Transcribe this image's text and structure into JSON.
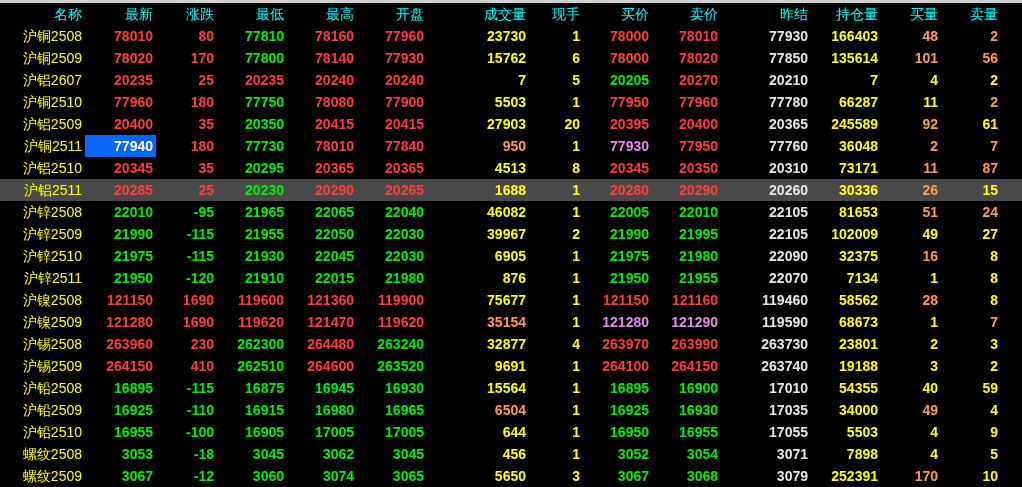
{
  "columns": [
    "名称",
    "最新",
    "涨跌",
    "最低",
    "最高",
    "开盘",
    "成交量",
    "现手",
    "买价",
    "卖价",
    "昨结",
    "持仓量",
    "买量",
    "卖量"
  ],
  "rows": [
    {
      "name": "沪铜2508",
      "selected": false,
      "cursor": false,
      "cells": [
        {
          "text": "78010",
          "color": "#ff3c3c"
        },
        {
          "text": "80",
          "color": "#ff3c3c"
        },
        {
          "text": "77810",
          "color": "#00ee00"
        },
        {
          "text": "78160",
          "color": "#ff3c3c"
        },
        {
          "text": "77960",
          "color": "#ff3c3c"
        },
        {
          "text": "23730",
          "color": "#ffff00"
        },
        {
          "text": "1",
          "color": "#ffff00"
        },
        {
          "text": "78000",
          "color": "#ff3c3c"
        },
        {
          "text": "78010",
          "color": "#ff3c3c"
        },
        {
          "text": "77930",
          "color": "#e6e6e6"
        },
        {
          "text": "166403",
          "color": "#ffff00"
        },
        {
          "text": "48",
          "color": "#ff9a4a"
        },
        {
          "text": "2",
          "color": "#ff9a4a"
        }
      ]
    },
    {
      "name": "沪铜2509",
      "selected": false,
      "cursor": false,
      "cells": [
        {
          "text": "78020",
          "color": "#ff3c3c"
        },
        {
          "text": "170",
          "color": "#ff3c3c"
        },
        {
          "text": "77800",
          "color": "#00ee00"
        },
        {
          "text": "78140",
          "color": "#ff3c3c"
        },
        {
          "text": "77930",
          "color": "#ff3c3c"
        },
        {
          "text": "15762",
          "color": "#ffff00"
        },
        {
          "text": "6",
          "color": "#ffff00"
        },
        {
          "text": "78000",
          "color": "#ff3c3c"
        },
        {
          "text": "78020",
          "color": "#ff3c3c"
        },
        {
          "text": "77850",
          "color": "#e6e6e6"
        },
        {
          "text": "135614",
          "color": "#ffff00"
        },
        {
          "text": "101",
          "color": "#ff9a4a"
        },
        {
          "text": "56",
          "color": "#ff9a4a"
        }
      ]
    },
    {
      "name": "沪铝2607",
      "selected": false,
      "cursor": false,
      "cells": [
        {
          "text": "20235",
          "color": "#ff3c3c"
        },
        {
          "text": "25",
          "color": "#ff3c3c"
        },
        {
          "text": "20235",
          "color": "#ff3c3c"
        },
        {
          "text": "20240",
          "color": "#ff3c3c"
        },
        {
          "text": "20240",
          "color": "#ff3c3c"
        },
        {
          "text": "7",
          "color": "#ffff00"
        },
        {
          "text": "5",
          "color": "#ffff00"
        },
        {
          "text": "20205",
          "color": "#00ee00"
        },
        {
          "text": "20270",
          "color": "#ff3c3c"
        },
        {
          "text": "20210",
          "color": "#e6e6e6"
        },
        {
          "text": "7",
          "color": "#ffff00"
        },
        {
          "text": "4",
          "color": "#ffff00"
        },
        {
          "text": "2",
          "color": "#ffff00"
        }
      ]
    },
    {
      "name": "沪铜2510",
      "selected": false,
      "cursor": false,
      "cells": [
        {
          "text": "77960",
          "color": "#ff3c3c"
        },
        {
          "text": "180",
          "color": "#ff3c3c"
        },
        {
          "text": "77750",
          "color": "#00ee00"
        },
        {
          "text": "78080",
          "color": "#ff3c3c"
        },
        {
          "text": "77900",
          "color": "#ff3c3c"
        },
        {
          "text": "5503",
          "color": "#ffff00"
        },
        {
          "text": "1",
          "color": "#ffff00"
        },
        {
          "text": "77950",
          "color": "#ff3c3c"
        },
        {
          "text": "77960",
          "color": "#ff3c3c"
        },
        {
          "text": "77780",
          "color": "#e6e6e6"
        },
        {
          "text": "66287",
          "color": "#ffff00"
        },
        {
          "text": "11",
          "color": "#ffff00"
        },
        {
          "text": "2",
          "color": "#ff9a4a"
        }
      ]
    },
    {
      "name": "沪铝2509",
      "selected": false,
      "cursor": false,
      "cells": [
        {
          "text": "20400",
          "color": "#ff3c3c"
        },
        {
          "text": "35",
          "color": "#ff3c3c"
        },
        {
          "text": "20350",
          "color": "#00ee00"
        },
        {
          "text": "20415",
          "color": "#ff3c3c"
        },
        {
          "text": "20415",
          "color": "#ff3c3c"
        },
        {
          "text": "27903",
          "color": "#ffff00"
        },
        {
          "text": "20",
          "color": "#ffff00"
        },
        {
          "text": "20395",
          "color": "#ff3c3c"
        },
        {
          "text": "20400",
          "color": "#ff3c3c"
        },
        {
          "text": "20365",
          "color": "#e6e6e6"
        },
        {
          "text": "245589",
          "color": "#ffff00"
        },
        {
          "text": "92",
          "color": "#ff9a4a"
        },
        {
          "text": "61",
          "color": "#ffff00"
        }
      ]
    },
    {
      "name": "沪铜2511",
      "selected": false,
      "cursor": true,
      "cells": [
        {
          "text": "77940",
          "color": "#ffffff"
        },
        {
          "text": "180",
          "color": "#ff3c3c"
        },
        {
          "text": "77730",
          "color": "#00ee00"
        },
        {
          "text": "78010",
          "color": "#ff3c3c"
        },
        {
          "text": "77840",
          "color": "#ff3c3c"
        },
        {
          "text": "950",
          "color": "#ff9a4a"
        },
        {
          "text": "1",
          "color": "#ffff00"
        },
        {
          "text": "77930",
          "color": "#e58ae5"
        },
        {
          "text": "77950",
          "color": "#ff3c3c"
        },
        {
          "text": "77760",
          "color": "#e6e6e6"
        },
        {
          "text": "36048",
          "color": "#ffff00"
        },
        {
          "text": "2",
          "color": "#ff9a4a"
        },
        {
          "text": "7",
          "color": "#ff9a4a"
        }
      ]
    },
    {
      "name": "沪铝2510",
      "selected": false,
      "cursor": false,
      "cells": [
        {
          "text": "20345",
          "color": "#ff3c3c"
        },
        {
          "text": "35",
          "color": "#ff3c3c"
        },
        {
          "text": "20295",
          "color": "#00ee00"
        },
        {
          "text": "20365",
          "color": "#ff3c3c"
        },
        {
          "text": "20365",
          "color": "#ff3c3c"
        },
        {
          "text": "4513",
          "color": "#ffff00"
        },
        {
          "text": "8",
          "color": "#ffff00"
        },
        {
          "text": "20345",
          "color": "#ff3c3c"
        },
        {
          "text": "20350",
          "color": "#ff3c3c"
        },
        {
          "text": "20310",
          "color": "#e6e6e6"
        },
        {
          "text": "73171",
          "color": "#ffff00"
        },
        {
          "text": "11",
          "color": "#ff9a4a"
        },
        {
          "text": "87",
          "color": "#ff9a4a"
        }
      ]
    },
    {
      "name": "沪铝2511",
      "selected": true,
      "cursor": false,
      "cells": [
        {
          "text": "20285",
          "color": "#ff3c3c"
        },
        {
          "text": "25",
          "color": "#ff3c3c"
        },
        {
          "text": "20230",
          "color": "#00ee00"
        },
        {
          "text": "20290",
          "color": "#ff3c3c"
        },
        {
          "text": "20265",
          "color": "#ff3c3c"
        },
        {
          "text": "1688",
          "color": "#ffff00"
        },
        {
          "text": "1",
          "color": "#ffff00"
        },
        {
          "text": "20280",
          "color": "#ff3c3c"
        },
        {
          "text": "20290",
          "color": "#ff3c3c"
        },
        {
          "text": "20260",
          "color": "#e6e6e6"
        },
        {
          "text": "30336",
          "color": "#ffff00"
        },
        {
          "text": "26",
          "color": "#ff9a4a"
        },
        {
          "text": "15",
          "color": "#ffff00"
        }
      ]
    },
    {
      "name": "沪锌2508",
      "selected": false,
      "cursor": false,
      "cells": [
        {
          "text": "22010",
          "color": "#00ee00"
        },
        {
          "text": "-95",
          "color": "#00ee00"
        },
        {
          "text": "21965",
          "color": "#00ee00"
        },
        {
          "text": "22065",
          "color": "#00ee00"
        },
        {
          "text": "22040",
          "color": "#00ee00"
        },
        {
          "text": "46082",
          "color": "#ffff00"
        },
        {
          "text": "1",
          "color": "#ffff00"
        },
        {
          "text": "22005",
          "color": "#00ee00"
        },
        {
          "text": "22010",
          "color": "#00ee00"
        },
        {
          "text": "22105",
          "color": "#e6e6e6"
        },
        {
          "text": "81653",
          "color": "#ffff00"
        },
        {
          "text": "51",
          "color": "#ff9a4a"
        },
        {
          "text": "24",
          "color": "#ff9a4a"
        }
      ]
    },
    {
      "name": "沪锌2509",
      "selected": false,
      "cursor": false,
      "cells": [
        {
          "text": "21990",
          "color": "#00ee00"
        },
        {
          "text": "-115",
          "color": "#00ee00"
        },
        {
          "text": "21955",
          "color": "#00ee00"
        },
        {
          "text": "22050",
          "color": "#00ee00"
        },
        {
          "text": "22030",
          "color": "#00ee00"
        },
        {
          "text": "39967",
          "color": "#ffff00"
        },
        {
          "text": "2",
          "color": "#ffff00"
        },
        {
          "text": "21990",
          "color": "#00ee00"
        },
        {
          "text": "21995",
          "color": "#00ee00"
        },
        {
          "text": "22105",
          "color": "#e6e6e6"
        },
        {
          "text": "102009",
          "color": "#ffff00"
        },
        {
          "text": "49",
          "color": "#ffff00"
        },
        {
          "text": "27",
          "color": "#ffff00"
        }
      ]
    },
    {
      "name": "沪锌2510",
      "selected": false,
      "cursor": false,
      "cells": [
        {
          "text": "21975",
          "color": "#00ee00"
        },
        {
          "text": "-115",
          "color": "#00ee00"
        },
        {
          "text": "21930",
          "color": "#00ee00"
        },
        {
          "text": "22045",
          "color": "#00ee00"
        },
        {
          "text": "22030",
          "color": "#00ee00"
        },
        {
          "text": "6905",
          "color": "#ffff00"
        },
        {
          "text": "1",
          "color": "#ffff00"
        },
        {
          "text": "21975",
          "color": "#00ee00"
        },
        {
          "text": "21980",
          "color": "#00ee00"
        },
        {
          "text": "22090",
          "color": "#e6e6e6"
        },
        {
          "text": "32375",
          "color": "#ffff00"
        },
        {
          "text": "16",
          "color": "#ff9a4a"
        },
        {
          "text": "8",
          "color": "#ffff00"
        }
      ]
    },
    {
      "name": "沪锌2511",
      "selected": false,
      "cursor": false,
      "cells": [
        {
          "text": "21950",
          "color": "#00ee00"
        },
        {
          "text": "-120",
          "color": "#00ee00"
        },
        {
          "text": "21910",
          "color": "#00ee00"
        },
        {
          "text": "22015",
          "color": "#00ee00"
        },
        {
          "text": "21980",
          "color": "#00ee00"
        },
        {
          "text": "876",
          "color": "#ffff00"
        },
        {
          "text": "1",
          "color": "#ffff00"
        },
        {
          "text": "21950",
          "color": "#00ee00"
        },
        {
          "text": "21955",
          "color": "#00ee00"
        },
        {
          "text": "22070",
          "color": "#e6e6e6"
        },
        {
          "text": "7134",
          "color": "#ffff00"
        },
        {
          "text": "1",
          "color": "#ffff00"
        },
        {
          "text": "8",
          "color": "#ffff00"
        }
      ]
    },
    {
      "name": "沪镍2508",
      "selected": false,
      "cursor": false,
      "cells": [
        {
          "text": "121150",
          "color": "#ff3c3c"
        },
        {
          "text": "1690",
          "color": "#ff3c3c"
        },
        {
          "text": "119600",
          "color": "#ff3c3c"
        },
        {
          "text": "121360",
          "color": "#ff3c3c"
        },
        {
          "text": "119900",
          "color": "#ff3c3c"
        },
        {
          "text": "75677",
          "color": "#ffff00"
        },
        {
          "text": "1",
          "color": "#ffff00"
        },
        {
          "text": "121150",
          "color": "#ff3c3c"
        },
        {
          "text": "121160",
          "color": "#ff3c3c"
        },
        {
          "text": "119460",
          "color": "#e6e6e6"
        },
        {
          "text": "58562",
          "color": "#ffff00"
        },
        {
          "text": "28",
          "color": "#ff9a4a"
        },
        {
          "text": "8",
          "color": "#ffff00"
        }
      ]
    },
    {
      "name": "沪镍2509",
      "selected": false,
      "cursor": false,
      "cells": [
        {
          "text": "121280",
          "color": "#ff3c3c"
        },
        {
          "text": "1690",
          "color": "#ff3c3c"
        },
        {
          "text": "119620",
          "color": "#ff3c3c"
        },
        {
          "text": "121470",
          "color": "#ff3c3c"
        },
        {
          "text": "119620",
          "color": "#ff3c3c"
        },
        {
          "text": "35154",
          "color": "#ff9a4a"
        },
        {
          "text": "1",
          "color": "#ffff00"
        },
        {
          "text": "121280",
          "color": "#e58ae5"
        },
        {
          "text": "121290",
          "color": "#e58ae5"
        },
        {
          "text": "119590",
          "color": "#e6e6e6"
        },
        {
          "text": "68673",
          "color": "#ffff00"
        },
        {
          "text": "1",
          "color": "#ffff00"
        },
        {
          "text": "7",
          "color": "#ff9a4a"
        }
      ]
    },
    {
      "name": "沪锡2508",
      "selected": false,
      "cursor": false,
      "cells": [
        {
          "text": "263960",
          "color": "#ff3c3c"
        },
        {
          "text": "230",
          "color": "#ff3c3c"
        },
        {
          "text": "262300",
          "color": "#00ee00"
        },
        {
          "text": "264480",
          "color": "#ff3c3c"
        },
        {
          "text": "263240",
          "color": "#00ee00"
        },
        {
          "text": "32877",
          "color": "#ffff00"
        },
        {
          "text": "4",
          "color": "#ffff00"
        },
        {
          "text": "263970",
          "color": "#ff3c3c"
        },
        {
          "text": "263990",
          "color": "#ff3c3c"
        },
        {
          "text": "263730",
          "color": "#e6e6e6"
        },
        {
          "text": "23801",
          "color": "#ffff00"
        },
        {
          "text": "2",
          "color": "#ffff00"
        },
        {
          "text": "3",
          "color": "#ffff00"
        }
      ]
    },
    {
      "name": "沪锡2509",
      "selected": false,
      "cursor": false,
      "cells": [
        {
          "text": "264150",
          "color": "#ff3c3c"
        },
        {
          "text": "410",
          "color": "#ff3c3c"
        },
        {
          "text": "262510",
          "color": "#00ee00"
        },
        {
          "text": "264600",
          "color": "#ff3c3c"
        },
        {
          "text": "263520",
          "color": "#00ee00"
        },
        {
          "text": "9691",
          "color": "#ffff00"
        },
        {
          "text": "1",
          "color": "#ffff00"
        },
        {
          "text": "264100",
          "color": "#ff3c3c"
        },
        {
          "text": "264150",
          "color": "#ff3c3c"
        },
        {
          "text": "263740",
          "color": "#e6e6e6"
        },
        {
          "text": "19188",
          "color": "#ffff00"
        },
        {
          "text": "3",
          "color": "#ffff00"
        },
        {
          "text": "2",
          "color": "#ffff00"
        }
      ]
    },
    {
      "name": "沪铅2508",
      "selected": false,
      "cursor": false,
      "cells": [
        {
          "text": "16895",
          "color": "#00ee00"
        },
        {
          "text": "-115",
          "color": "#00ee00"
        },
        {
          "text": "16875",
          "color": "#00ee00"
        },
        {
          "text": "16945",
          "color": "#00ee00"
        },
        {
          "text": "16930",
          "color": "#00ee00"
        },
        {
          "text": "15564",
          "color": "#ffff00"
        },
        {
          "text": "1",
          "color": "#ffff00"
        },
        {
          "text": "16895",
          "color": "#00ee00"
        },
        {
          "text": "16900",
          "color": "#00ee00"
        },
        {
          "text": "17010",
          "color": "#e6e6e6"
        },
        {
          "text": "54355",
          "color": "#ffff00"
        },
        {
          "text": "40",
          "color": "#ffff00"
        },
        {
          "text": "59",
          "color": "#ffff00"
        }
      ]
    },
    {
      "name": "沪铅2509",
      "selected": false,
      "cursor": false,
      "cells": [
        {
          "text": "16925",
          "color": "#00ee00"
        },
        {
          "text": "-110",
          "color": "#00ee00"
        },
        {
          "text": "16915",
          "color": "#00ee00"
        },
        {
          "text": "16980",
          "color": "#00ee00"
        },
        {
          "text": "16965",
          "color": "#00ee00"
        },
        {
          "text": "6504",
          "color": "#ff9a4a"
        },
        {
          "text": "1",
          "color": "#ffff00"
        },
        {
          "text": "16925",
          "color": "#00ee00"
        },
        {
          "text": "16930",
          "color": "#00ee00"
        },
        {
          "text": "17035",
          "color": "#e6e6e6"
        },
        {
          "text": "34000",
          "color": "#ffff00"
        },
        {
          "text": "49",
          "color": "#ff9a4a"
        },
        {
          "text": "4",
          "color": "#ffff00"
        }
      ]
    },
    {
      "name": "沪铅2510",
      "selected": false,
      "cursor": false,
      "cells": [
        {
          "text": "16955",
          "color": "#00ee00"
        },
        {
          "text": "-100",
          "color": "#00ee00"
        },
        {
          "text": "16905",
          "color": "#00ee00"
        },
        {
          "text": "17005",
          "color": "#00ee00"
        },
        {
          "text": "17005",
          "color": "#00ee00"
        },
        {
          "text": "644",
          "color": "#ffff00"
        },
        {
          "text": "1",
          "color": "#ffff00"
        },
        {
          "text": "16950",
          "color": "#00ee00"
        },
        {
          "text": "16955",
          "color": "#00ee00"
        },
        {
          "text": "17055",
          "color": "#e6e6e6"
        },
        {
          "text": "5503",
          "color": "#ffff00"
        },
        {
          "text": "4",
          "color": "#ffff00"
        },
        {
          "text": "9",
          "color": "#ffff00"
        }
      ]
    },
    {
      "name": "螺纹2508",
      "selected": false,
      "cursor": false,
      "cells": [
        {
          "text": "3053",
          "color": "#00ee00"
        },
        {
          "text": "-18",
          "color": "#00ee00"
        },
        {
          "text": "3045",
          "color": "#00ee00"
        },
        {
          "text": "3062",
          "color": "#00ee00"
        },
        {
          "text": "3045",
          "color": "#00ee00"
        },
        {
          "text": "456",
          "color": "#ffff00"
        },
        {
          "text": "1",
          "color": "#ffff00"
        },
        {
          "text": "3052",
          "color": "#00ee00"
        },
        {
          "text": "3054",
          "color": "#00ee00"
        },
        {
          "text": "3071",
          "color": "#e6e6e6"
        },
        {
          "text": "7898",
          "color": "#ffff00"
        },
        {
          "text": "4",
          "color": "#ffff00"
        },
        {
          "text": "5",
          "color": "#ffff00"
        }
      ]
    },
    {
      "name": "螺纹2509",
      "selected": false,
      "cursor": false,
      "cells": [
        {
          "text": "3067",
          "color": "#00ee00"
        },
        {
          "text": "-12",
          "color": "#00ee00"
        },
        {
          "text": "3060",
          "color": "#00ee00"
        },
        {
          "text": "3074",
          "color": "#00ee00"
        },
        {
          "text": "3065",
          "color": "#00ee00"
        },
        {
          "text": "5650",
          "color": "#ffff00"
        },
        {
          "text": "3",
          "color": "#ffff00"
        },
        {
          "text": "3067",
          "color": "#00ee00"
        },
        {
          "text": "3068",
          "color": "#00ee00"
        },
        {
          "text": "3079",
          "color": "#e6e6e6"
        },
        {
          "text": "252391",
          "color": "#ffff00"
        },
        {
          "text": "170",
          "color": "#ff9a4a"
        },
        {
          "text": "10",
          "color": "#ffff00"
        }
      ]
    }
  ]
}
